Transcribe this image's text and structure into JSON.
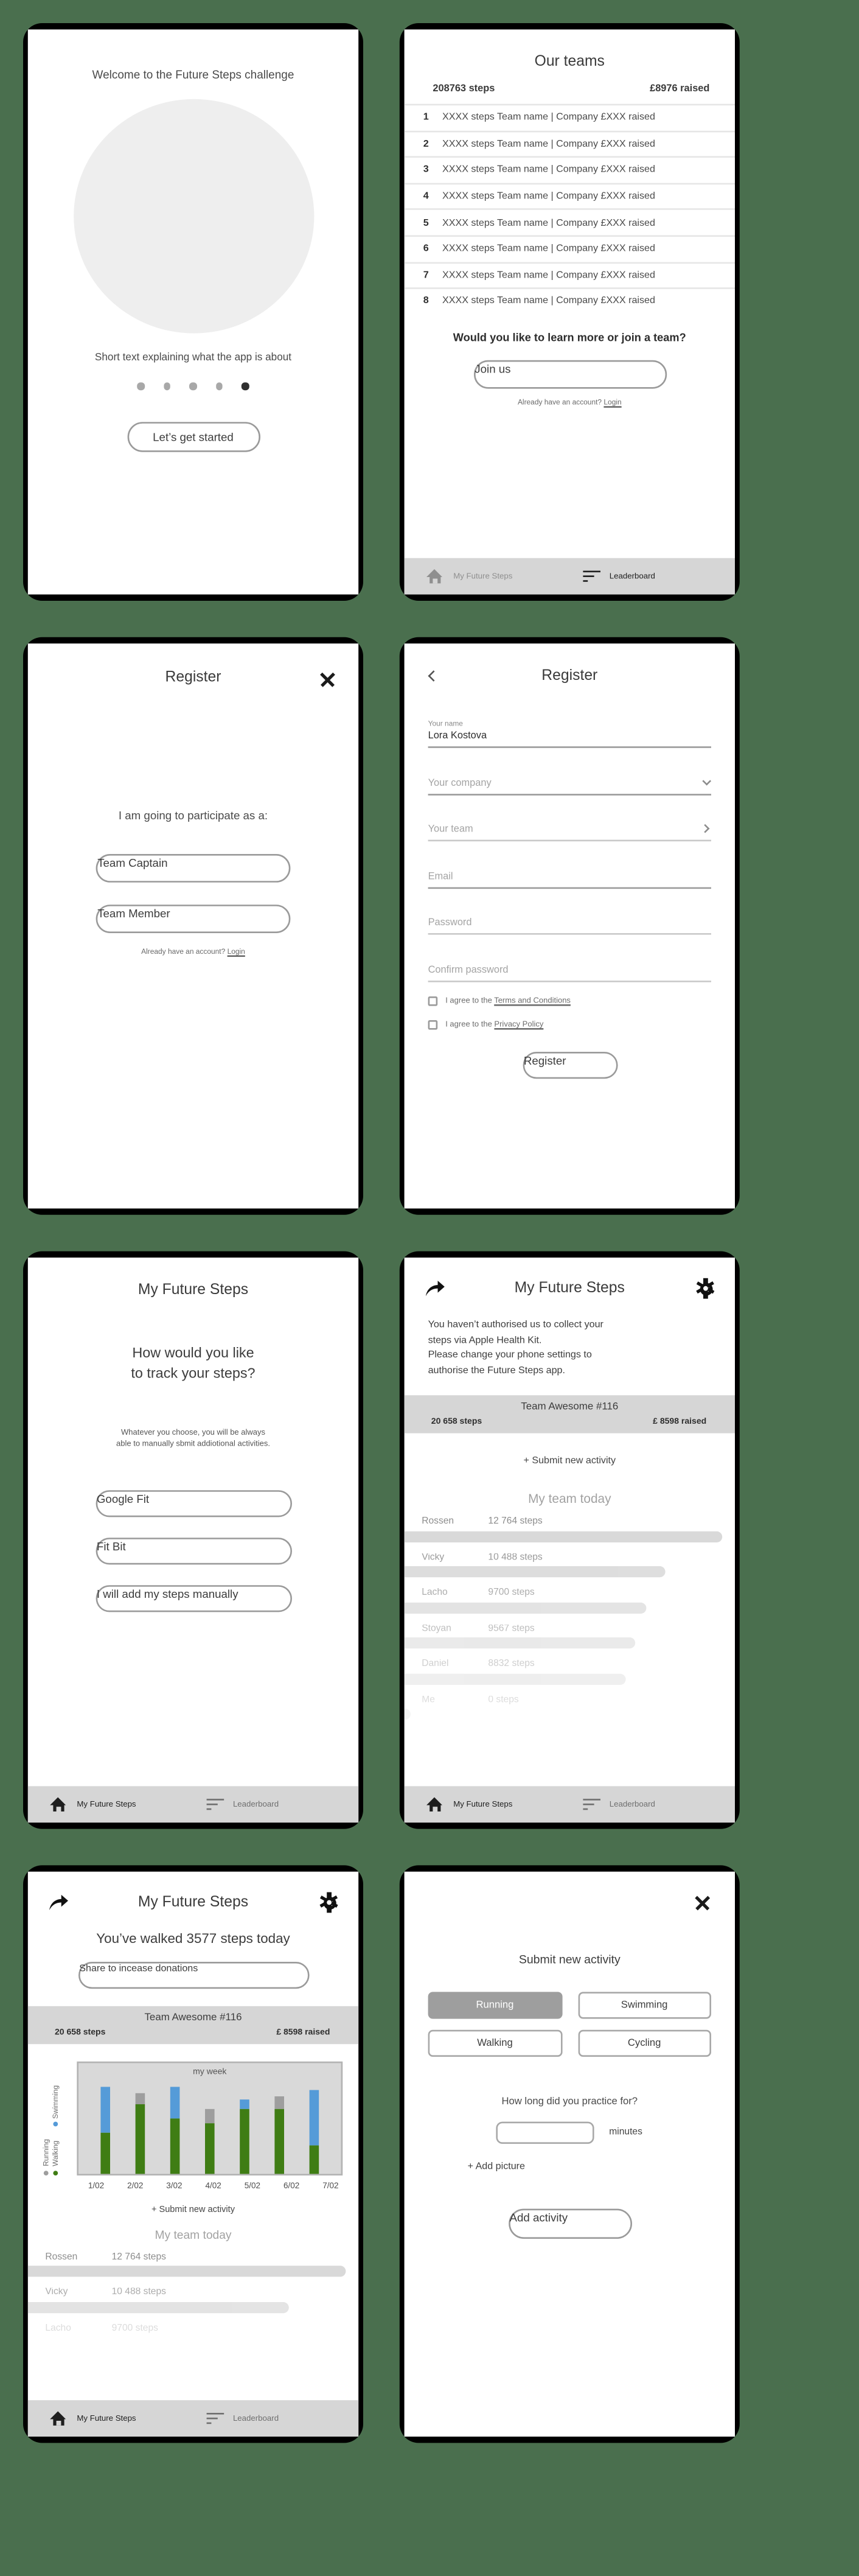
{
  "background_color": "#4a6f4e",
  "screen_welcome": {
    "heading": "Welcome to the Future Steps challenge",
    "subtext": "Short text explaining what the app is about",
    "dots_total": 5,
    "dots_active_index": 4,
    "cta_label": "Let’s get started"
  },
  "screen_teams": {
    "title": "Our teams",
    "total_steps": "208763 steps",
    "total_raised": "£8976 raised",
    "rows": [
      {
        "rank": "1",
        "text": "XXXX steps Team name | Company £XXX raised"
      },
      {
        "rank": "2",
        "text": "XXXX steps Team name | Company £XXX raised"
      },
      {
        "rank": "3",
        "text": "XXXX steps Team name | Company £XXX raised"
      },
      {
        "rank": "4",
        "text": "XXXX steps Team name | Company £XXX raised"
      },
      {
        "rank": "5",
        "text": "XXXX steps Team name | Company £XXX raised"
      },
      {
        "rank": "6",
        "text": "XXXX steps Team name | Company £XXX raised"
      },
      {
        "rank": "7",
        "text": "XXXX steps Team name | Company £XXX raised"
      },
      {
        "rank": "8",
        "text": "XXXX steps Team name | Company £XXX raised"
      }
    ],
    "ask": "Would you like to learn more or join a team?",
    "join_label": "Join us",
    "login_prefix": "Already have an account? ",
    "login_link": "Login"
  },
  "navbar": {
    "home_label": "My Future Steps",
    "leaderboard_label": "Leaderboard"
  },
  "screen_register_choice": {
    "title": "Register",
    "prompt": "I am going to participate as a:",
    "option_captain": "Team Captain",
    "option_member": "Team Member",
    "login_prefix": "Already have an account? ",
    "login_link": "Login"
  },
  "screen_register_form": {
    "title": "Register",
    "name_label": "Your name",
    "name_value": "Lora Kostova",
    "company_placeholder": "Your company",
    "team_placeholder": "Your team",
    "email_placeholder": "Email",
    "password_placeholder": "Password",
    "confirm_placeholder": "Confirm password",
    "terms_prefix": "I agree to the ",
    "terms_link": "Terms and Conditions",
    "privacy_prefix": "I agree to the ",
    "privacy_link": "Privacy Policy",
    "submit_label": "Register"
  },
  "screen_track": {
    "title": "My Future Steps",
    "question_line1": "How would you like",
    "question_line2": "to track your steps?",
    "note_line1": "Whatever you choose, you will be always",
    "note_line2": "able to manually sbmit addiotional activities.",
    "option_google_fit": "Google Fit",
    "option_fitbit": "Fit Bit",
    "option_manual": "I will add my steps manually"
  },
  "screen_mysteps_noauth": {
    "title": "My Future Steps",
    "auth_message_line1": "You haven’t authorised us to collect your",
    "auth_message_line2": "steps via Apple Health Kit.",
    "auth_message_line3": "Please change your phone settings to",
    "auth_message_line4": "authorise the Future Steps app.",
    "team_name": "Team Awesome #116",
    "team_steps": "20 658 steps",
    "team_raised": "£ 8598 raised",
    "submit_activity_link": "+ Submit new activity",
    "my_team_today": "My team today",
    "members": [
      {
        "name": "Rossen",
        "steps": "12 764 steps",
        "pct": 96
      },
      {
        "name": "Vicky",
        "steps": "10 488 steps",
        "pct": 79
      },
      {
        "name": "Lacho",
        "steps": "9700 steps",
        "pct": 73
      },
      {
        "name": "Stoyan",
        "steps": "9567 steps",
        "pct": 70
      },
      {
        "name": "Daniel",
        "steps": "8832 steps",
        "pct": 67
      },
      {
        "name": "Me",
        "steps": "0 steps",
        "pct": 2
      }
    ]
  },
  "screen_mysteps_chart": {
    "title": "My Future Steps",
    "walked": "You’ve walked 3577 steps today",
    "share_label": "Share to incease donations",
    "team_name": "Team Awesome #116",
    "team_steps": "20 658 steps",
    "team_raised": "£ 8598 raised",
    "submit_activity_link": "+ Submit new activity",
    "my_team_today": "My team today",
    "members": [
      {
        "name": "Rossen",
        "steps": "12 764 steps",
        "pct": 96
      },
      {
        "name": "Vicky",
        "steps": "10 488 steps",
        "pct": 79
      },
      {
        "name": "Lacho",
        "steps": "9700 steps",
        "pct": 73
      }
    ]
  },
  "chart_data": {
    "type": "bar",
    "title": "my week",
    "stacked": true,
    "categories": [
      "1/02",
      "2/02",
      "3/02",
      "4/02",
      "5/02",
      "6/02",
      "7/02"
    ],
    "series": [
      {
        "name": "Walking",
        "color": "#3f7d14",
        "values": [
          46,
          78,
          62,
          57,
          74,
          73,
          32
        ]
      },
      {
        "name": "Running",
        "color": "#9e9e9e",
        "values": [
          0,
          14,
          0,
          16,
          0,
          14,
          0
        ]
      },
      {
        "name": "Swimming",
        "color": "#559bd8",
        "values": [
          52,
          0,
          36,
          0,
          10,
          0,
          62
        ]
      }
    ],
    "legend": [
      "Running",
      "Swimming",
      "Walking"
    ],
    "legend_position": "left",
    "xlabel": "",
    "ylabel": "",
    "grid": false,
    "plot_background": "#d9d9d9"
  },
  "screen_submit_activity": {
    "title": "Submit new activity",
    "activities": [
      {
        "label": "Running",
        "selected": true
      },
      {
        "label": "Swimming",
        "selected": false
      },
      {
        "label": "Walking",
        "selected": false
      },
      {
        "label": "Cycling",
        "selected": false
      }
    ],
    "duration_question": "How long did you practice for?",
    "duration_value": "",
    "duration_unit": "minutes",
    "add_picture_label": "+ Add picture",
    "submit_label": "Add activity"
  }
}
